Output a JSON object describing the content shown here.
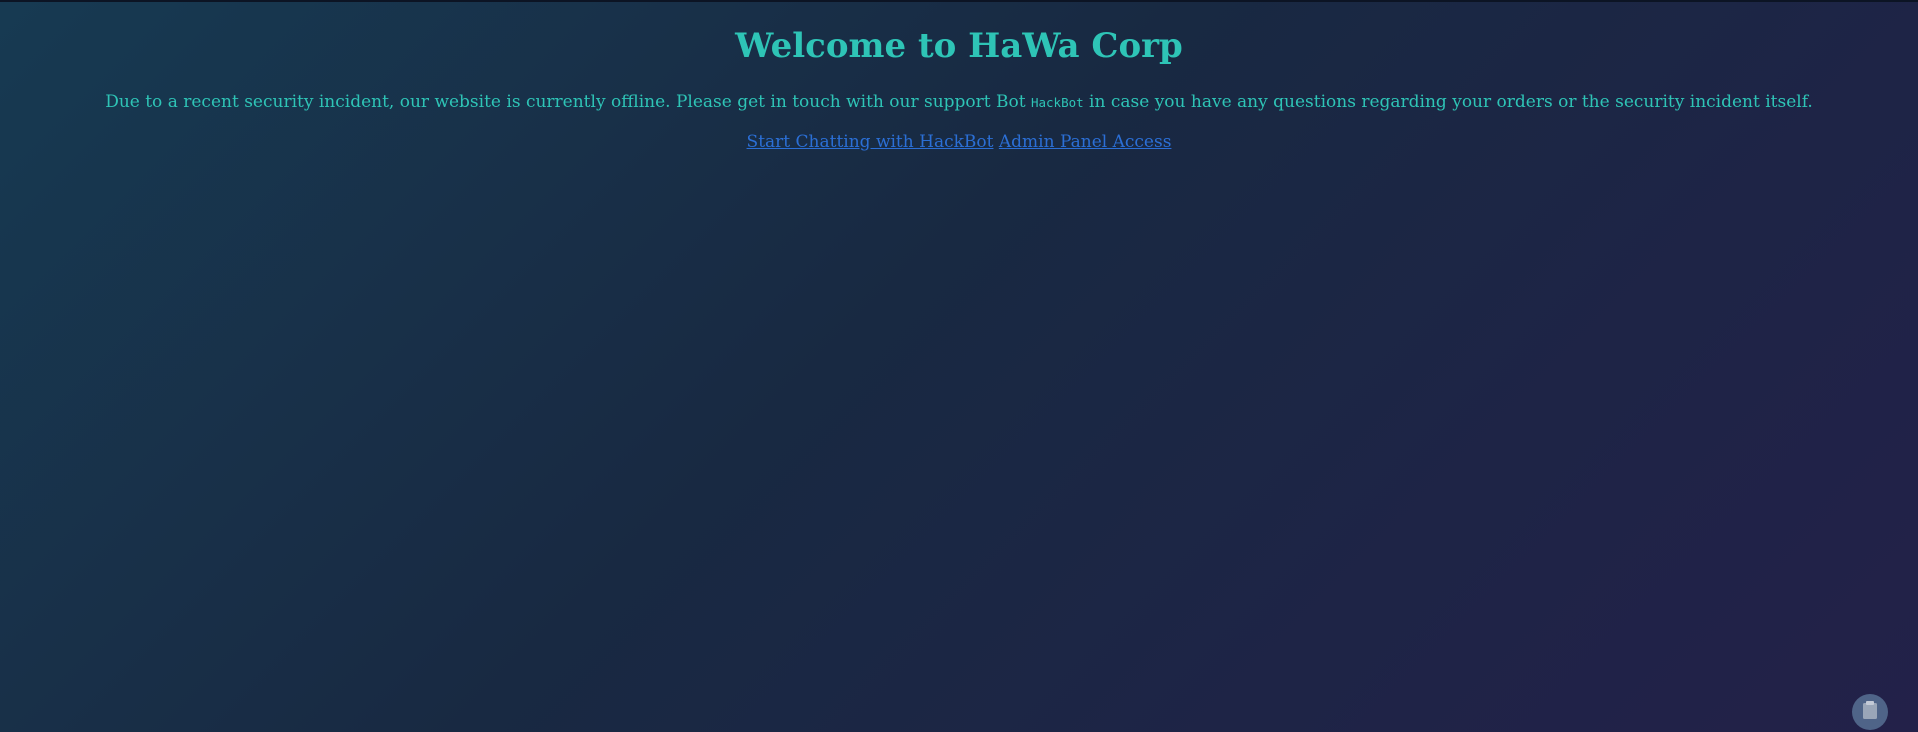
{
  "header": {
    "title": "Welcome to HaWa Corp"
  },
  "notice": {
    "text_before": "Due to a recent security incident, our website is currently offline. Please get in touch with our support Bot ",
    "bot_name": "HackBot",
    "text_after": " in case you have any questions regarding your orders or the security incident itself."
  },
  "links": {
    "chat": "Start Chatting with HackBot",
    "admin": "Admin Panel Access"
  },
  "floating_button": {
    "icon": "clipboard-icon"
  },
  "colors": {
    "accent": "#2ec4b6",
    "link": "#2b6fd6",
    "background_start": "#173a52",
    "background_end": "#232149"
  }
}
